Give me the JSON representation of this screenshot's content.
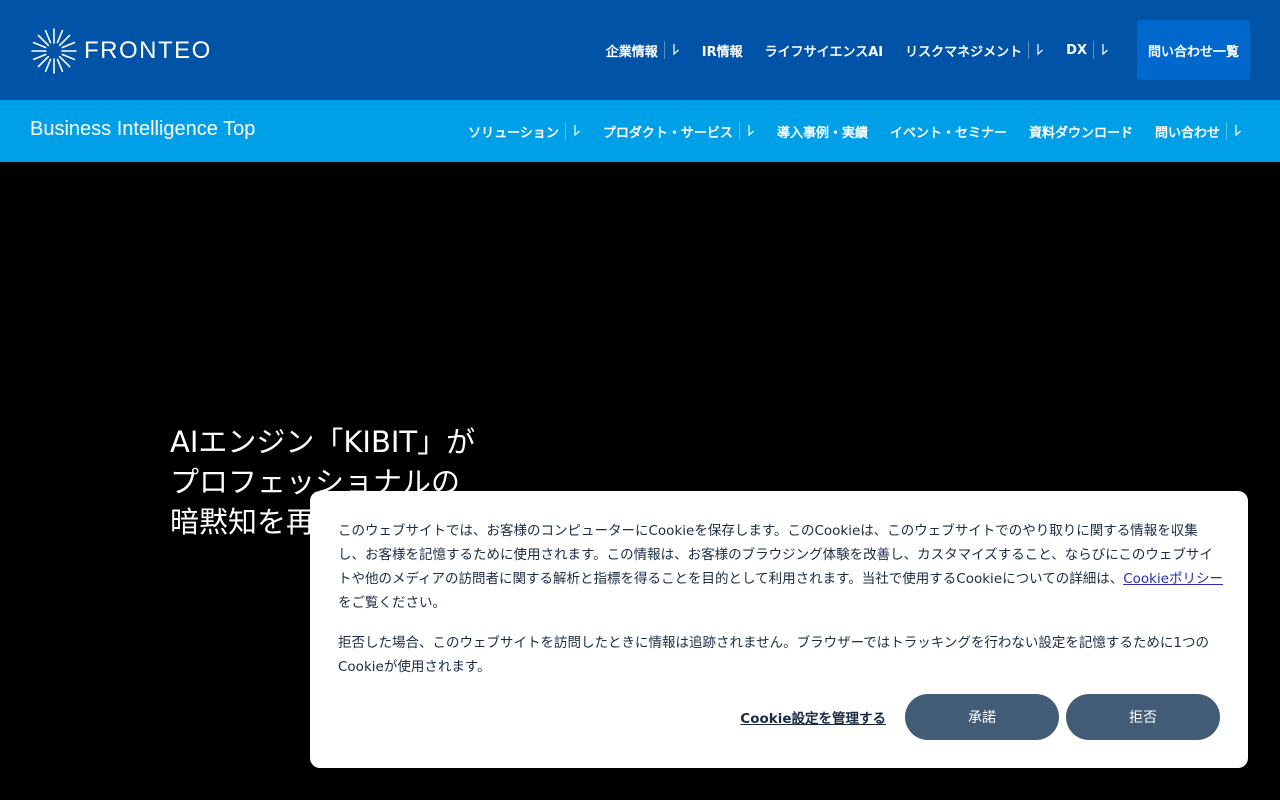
{
  "header": {
    "logo_text": "FRONTEO",
    "nav": [
      {
        "label": "企業情報",
        "has_dropdown": true
      },
      {
        "label": "IR情報",
        "has_dropdown": false
      },
      {
        "label": "ライフサイエンスAI",
        "has_dropdown": false
      },
      {
        "label": "リスクマネジメント",
        "has_dropdown": true
      },
      {
        "label": "DX",
        "has_dropdown": true
      }
    ],
    "contact_button": "問い合わせ一覧",
    "colors": {
      "background": "#0053a6",
      "button": "#0068cc"
    }
  },
  "subheader": {
    "title": "Business Intelligence Top",
    "nav": [
      {
        "label": "ソリューション",
        "has_dropdown": true
      },
      {
        "label": "プロダクト・サービス",
        "has_dropdown": true
      },
      {
        "label": "導入事例・実績",
        "has_dropdown": false
      },
      {
        "label": "イベント・セミナー",
        "has_dropdown": false
      },
      {
        "label": "資料ダウンロード",
        "has_dropdown": false
      },
      {
        "label": "問い合わせ",
        "has_dropdown": true
      }
    ],
    "colors": {
      "background": "#00a0e9"
    }
  },
  "hero": {
    "lines": [
      "AIエンジン「KIBIT」が",
      "プロフェッショナルの",
      "暗黙知を再"
    ]
  },
  "cookie_banner": {
    "paragraph1_before_link": "このウェブサイトでは、お客様のコンピューターにCookieを保存します。このCookieは、このウェブサイトでのやり取りに関する情報を収集し、お客様を記憶するために使用されます。この情報は、お客様のブラウジング体験を改善し、カスタマイズすること、ならびにこのウェブサイトや他のメディアの訪問者に関する解析と指標を得ることを目的として利用されます。当社で使用するCookieについての詳細は、",
    "policy_link": "Cookieポリシー",
    "paragraph1_after_link": "をご覧ください。",
    "paragraph2": "拒否した場合、このウェブサイトを訪問したときに情報は追跡されません。ブラウザーではトラッキングを行わない設定を記憶するために1つのCookieが使用されます。",
    "manage_link": "Cookie設定を管理する",
    "accept_button": "承諾",
    "reject_button": "拒否",
    "colors": {
      "button": "#425b76",
      "text": "#1b2b45",
      "link": "#2a2bb0"
    }
  }
}
